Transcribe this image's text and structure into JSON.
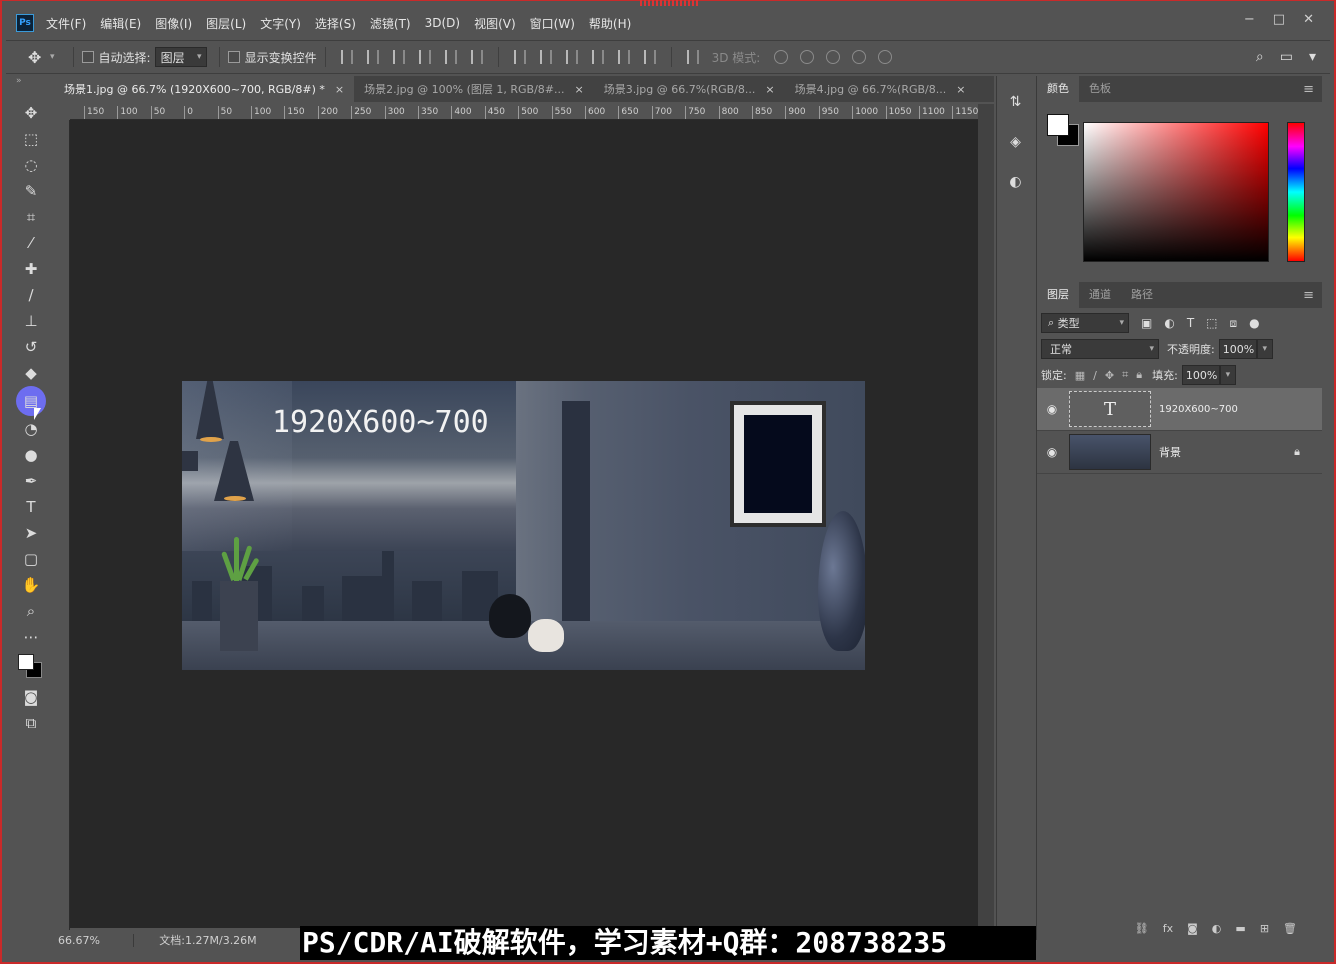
{
  "app": {
    "logo": "Ps"
  },
  "menu": [
    "文件(F)",
    "编辑(E)",
    "图像(I)",
    "图层(L)",
    "文字(Y)",
    "选择(S)",
    "滤镜(T)",
    "3D(D)",
    "视图(V)",
    "窗口(W)",
    "帮助(H)"
  ],
  "window_controls": {
    "minimize": "−",
    "maximize": "□",
    "close": "✕"
  },
  "options": {
    "auto_select_label": "自动选择:",
    "auto_select_value": "图层",
    "show_transform_label": "显示变换控件",
    "mode_3d_label": "3D 模式:"
  },
  "tabs": [
    {
      "label": "场景1.jpg @ 66.7% (1920X600~700, RGB/8#) *",
      "close": "×"
    },
    {
      "label": "场景2.jpg @ 100% (图层 1, RGB/8#...",
      "close": "×"
    },
    {
      "label": "场景3.jpg @ 66.7%(RGB/8...",
      "close": "×"
    },
    {
      "label": "场景4.jpg @ 66.7%(RGB/8...",
      "close": "×"
    }
  ],
  "ruler_ticks": [
    "150",
    "100",
    "50",
    "0",
    "50",
    "100",
    "150",
    "200",
    "250",
    "300",
    "350",
    "400",
    "450",
    "500",
    "550",
    "600",
    "650",
    "700",
    "750",
    "800",
    "850",
    "900",
    "950",
    "1000",
    "1050",
    "1100",
    "1150"
  ],
  "document": {
    "headline": "1920X600~700"
  },
  "status": {
    "zoom": "66.67%",
    "doc_size": "文档:1.27M/3.26M",
    "arrow": "〉"
  },
  "color_panel": {
    "tabs": [
      "颜色",
      "色板"
    ],
    "fg": "#ffffff",
    "bg": "#000000"
  },
  "layers_panel": {
    "tabs": [
      "图层",
      "通道",
      "路径"
    ],
    "filter_label": "类型",
    "blend_mode": "正常",
    "opacity_label": "不透明度:",
    "opacity_value": "100%",
    "lock_label": "锁定:",
    "fill_label": "填充:",
    "fill_value": "100%",
    "layers": [
      {
        "name": "1920X600~700",
        "type": "text",
        "thumb_glyph": "T",
        "selected": true
      },
      {
        "name": "背景",
        "type": "image",
        "locked": true
      }
    ],
    "footer_icons": [
      "link-icon",
      "fx-icon",
      "mask-icon",
      "adjustment-icon",
      "folder-icon",
      "new-layer-icon",
      "trash-icon"
    ],
    "footer_fx": "fx"
  },
  "caption": "PS/CDR/AI破解软件，学习素材+Q群：208738235"
}
